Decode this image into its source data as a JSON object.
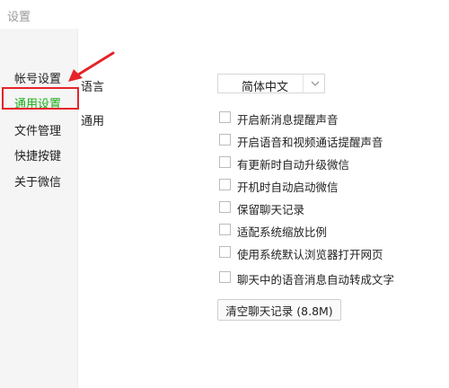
{
  "window": {
    "title": "设置"
  },
  "sidebar": {
    "items": [
      {
        "label": "帐号设置"
      },
      {
        "label": "通用设置"
      },
      {
        "label": "文件管理"
      },
      {
        "label": "快捷按键"
      },
      {
        "label": "关于微信"
      }
    ]
  },
  "language": {
    "label": "语言",
    "selected": "简体中文"
  },
  "general": {
    "label": "通用",
    "options": [
      {
        "label": "开启新消息提醒声音",
        "checked": false
      },
      {
        "label": "开启语音和视频通话提醒声音",
        "checked": false
      },
      {
        "label": "有更新时自动升级微信",
        "checked": false
      },
      {
        "label": "开机时自动启动微信",
        "checked": false
      },
      {
        "label": "保留聊天记录",
        "checked": false
      },
      {
        "label": "适配系统缩放比例",
        "checked": false
      },
      {
        "label": "使用系统默认浏览器打开网页",
        "checked": false
      },
      {
        "label": "聊天中的语音消息自动转成文字",
        "checked": false
      }
    ],
    "clear_button": "清空聊天记录 (8.8M)"
  },
  "colors": {
    "active_nav": "#1aad19",
    "annotation_red": "#e5232a",
    "sidebar_bg": "#f5f5f5"
  },
  "icons": {
    "dropdown": "chevron-down-icon",
    "annotation": "red-arrow-icon"
  }
}
